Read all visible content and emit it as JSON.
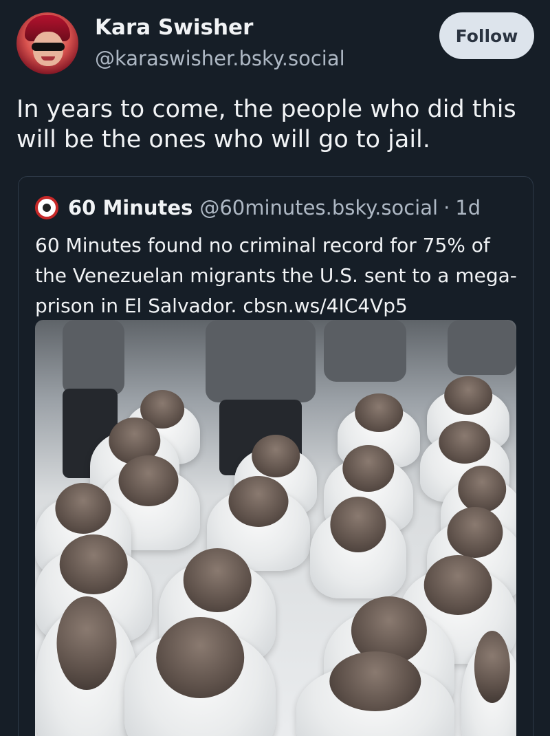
{
  "post": {
    "author": {
      "display_name": "Kara Swisher",
      "handle": "@karaswisher.bsky.social"
    },
    "follow_label": "Follow",
    "text": "In years to come, the people who did this will be the ones who will go to jail.",
    "quote": {
      "author_name": "60 Minutes",
      "author_handle": "@60minutes.bsky.social",
      "separator": "·",
      "time": "1d",
      "text": "60 Minutes found no criminal record for 75% of the Venezuelan migrants the U.S. sent to a mega-prison in El Salvador. cbsn.ws/4IC4Vp5"
    }
  },
  "colors": {
    "background": "#161e27",
    "text_primary": "#f1f3f5",
    "text_secondary": "#aeb8c4",
    "follow_button_bg": "#dde4ec",
    "card_border": "#2e3a48",
    "brand_red": "#c62828"
  },
  "icons": {
    "author_avatar": "avatar-photo",
    "quote_avatar": "60-minutes-logo"
  }
}
